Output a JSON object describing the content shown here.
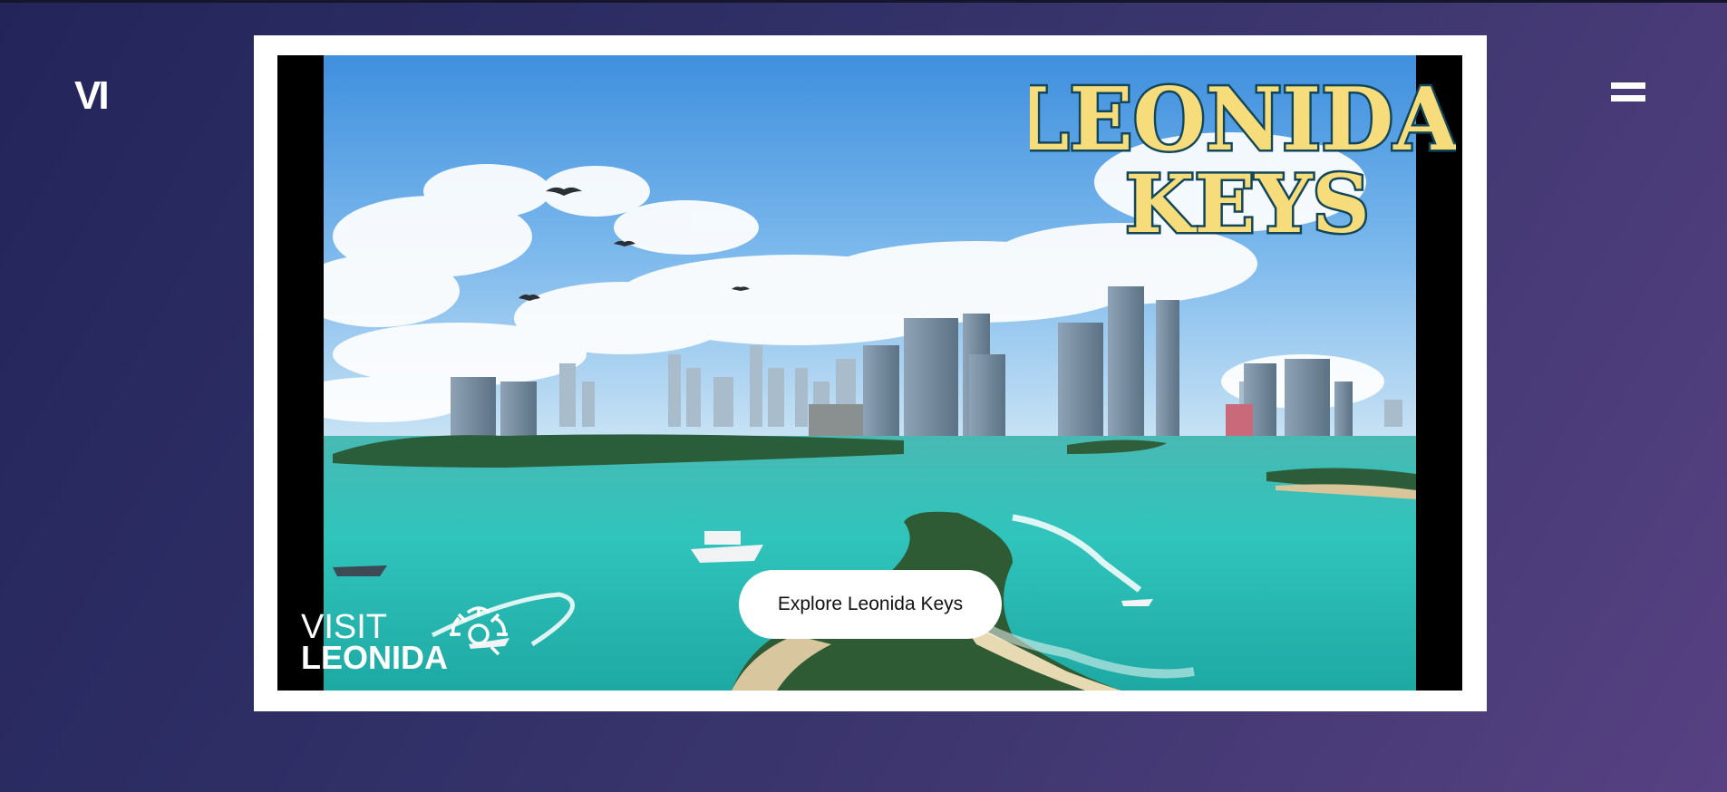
{
  "header": {
    "logo_text": "VI",
    "menu_icon": "hamburger-menu-icon"
  },
  "hero": {
    "destination_title_line1": "LEONIDA",
    "destination_title_line2": "KEYS",
    "brand_line1": "VISIT",
    "brand_line2": "LEONIDA",
    "cta_label": "Explore Leonida Keys"
  },
  "colors": {
    "background_start": "#23255a",
    "background_end": "#574182",
    "frame": "#ffffff",
    "title_fill": "#f6dc7a",
    "title_outline": "#12465a",
    "water": "#2fc4bc",
    "sky": "#4e9ee0"
  }
}
